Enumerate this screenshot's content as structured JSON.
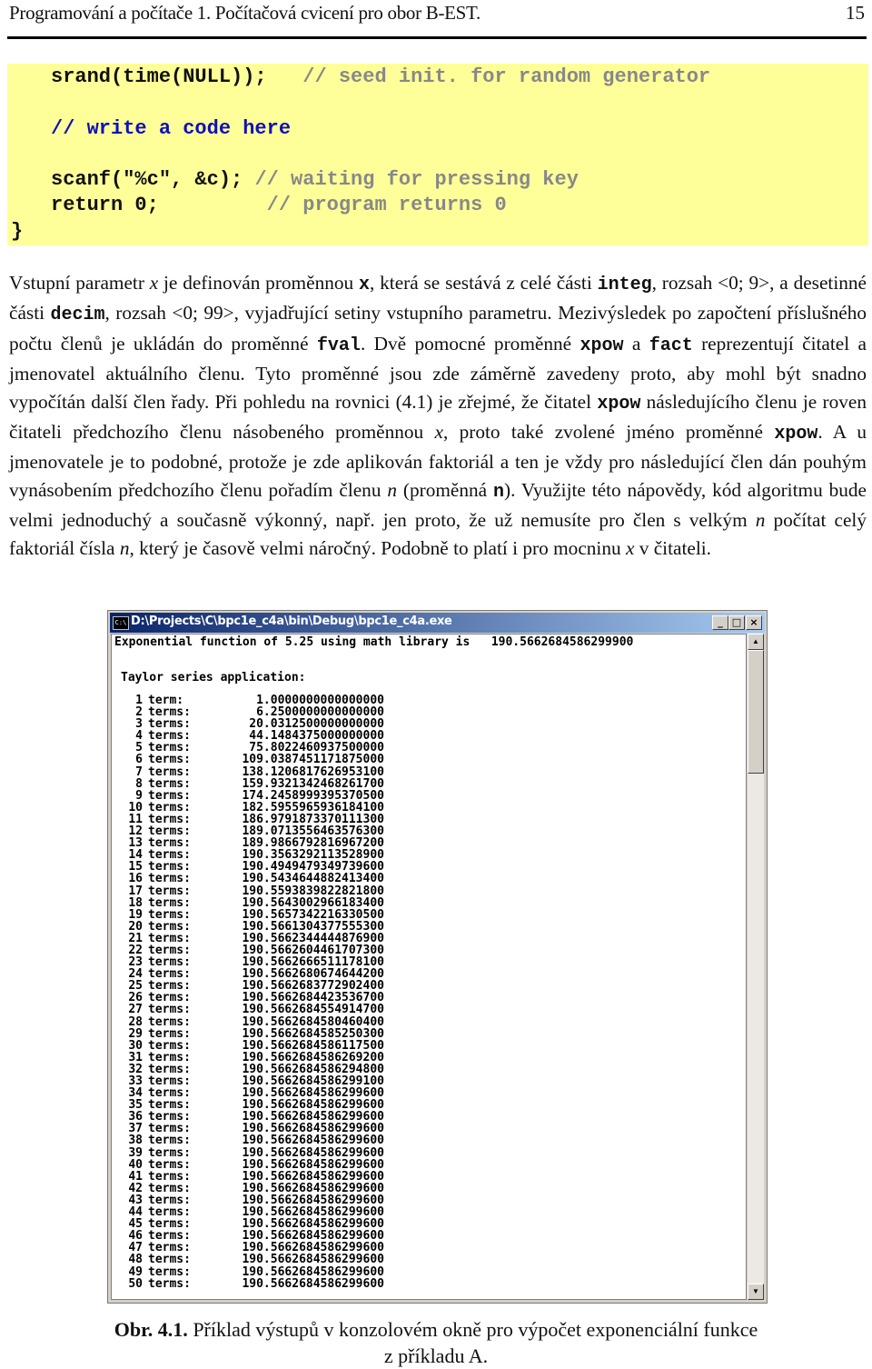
{
  "header": {
    "title": "Programování a počítače 1. Počítačová cvicení pro obor B-EST.",
    "page_number": "15"
  },
  "code_block": {
    "bg_color": "#ffff99",
    "lines": [
      {
        "code": "srand(time(NULL));",
        "pad": "   ",
        "comment": "// seed init. for random generator"
      },
      {
        "comment_blue": "// write a code here"
      },
      {
        "code": "scanf(\"%c\", &c);",
        "pad": " ",
        "comment": "// waiting for pressing key"
      },
      {
        "code": "return 0;",
        "pad": "         ",
        "comment": "// program returns 0"
      }
    ],
    "closing_brace": "}"
  },
  "paragraph": {
    "segments": [
      {
        "t": "Vstupní parametr "
      },
      {
        "t": "x",
        "s": "it"
      },
      {
        "t": " je definován proměnnou "
      },
      {
        "t": "x",
        "s": "mono"
      },
      {
        "t": ", která se sestává z celé části "
      },
      {
        "t": "integ",
        "s": "mono"
      },
      {
        "t": ", rozsah <0; 9>, a desetinné části "
      },
      {
        "t": "decim",
        "s": "mono"
      },
      {
        "t": ", rozsah <0; 99>, vyjadřující setiny vstupního parametru. Mezivýsledek po započtení příslušného počtu členů je ukládán do proměnné "
      },
      {
        "t": "fval",
        "s": "mono"
      },
      {
        "t": ". Dvě pomocné proměnné "
      },
      {
        "t": "xpow",
        "s": "mono"
      },
      {
        "t": " a "
      },
      {
        "t": "fact",
        "s": "mono"
      },
      {
        "t": " reprezentují čitatel a jmenovatel aktuálního členu. Tyto proměnné jsou zde záměrně zavedeny proto, aby mohl být snadno vypočítán další člen řady. Při pohledu na rovnici (4.1) je zřejmé, že čitatel "
      },
      {
        "t": "xpow",
        "s": "mono"
      },
      {
        "t": " následujícího členu je roven čitateli předchozího členu násobeného proměnnou "
      },
      {
        "t": "x",
        "s": "it"
      },
      {
        "t": ", proto také zvolené jméno proměnné "
      },
      {
        "t": "xpow",
        "s": "mono"
      },
      {
        "t": ". A u jmenovatele je to podobné, protože je zde aplikován faktoriál a ten je vždy pro následující člen dán pouhým vynásobením předchozího členu pořadím členu "
      },
      {
        "t": "n",
        "s": "it"
      },
      {
        "t": " (proměnná "
      },
      {
        "t": "n",
        "s": "mono"
      },
      {
        "t": "). Využijte této nápovědy, kód algoritmu bude velmi jednoduchý a současně výkonný, např. jen proto, že už nemusíte pro člen s velkým "
      },
      {
        "t": "n",
        "s": "it"
      },
      {
        "t": " počítat celý faktoriál čísla "
      },
      {
        "t": "n",
        "s": "it"
      },
      {
        "t": ", který je časově velmi náročný. Podobně to platí i pro mocninu "
      },
      {
        "t": "x",
        "s": "it"
      },
      {
        "t": " v čitateli."
      }
    ]
  },
  "console": {
    "title": "D:\\Projects\\C\\bpc1e_c4a\\bin\\Debug\\bpc1e_c4a.exe",
    "icon": "console-icon",
    "icon_text": "C:\\",
    "buttons": {
      "minimize": "_",
      "maximize": "□",
      "close": "×"
    },
    "scroll_up": "▲",
    "scroll_down": "▼",
    "title_color_start": "#0a246a",
    "title_color_end": "#a6caf0",
    "header_line": "Exponential function of 5.25 using math library is   190.5662684586299900",
    "taylor_label": "Taylor series application:",
    "rows": [
      {
        "n": "1",
        "label": "term:",
        "value": "1.0000000000000000"
      },
      {
        "n": "2",
        "label": "terms:",
        "value": "6.2500000000000000"
      },
      {
        "n": "3",
        "label": "terms:",
        "value": "20.0312500000000000"
      },
      {
        "n": "4",
        "label": "terms:",
        "value": "44.1484375000000000"
      },
      {
        "n": "5",
        "label": "terms:",
        "value": "75.8022460937500000"
      },
      {
        "n": "6",
        "label": "terms:",
        "value": "109.0387451171875000"
      },
      {
        "n": "7",
        "label": "terms:",
        "value": "138.1206817626953100"
      },
      {
        "n": "8",
        "label": "terms:",
        "value": "159.9321342468261700"
      },
      {
        "n": "9",
        "label": "terms:",
        "value": "174.2458999395370500"
      },
      {
        "n": "10",
        "label": "terms:",
        "value": "182.5955965936184100"
      },
      {
        "n": "11",
        "label": "terms:",
        "value": "186.9791873370111300"
      },
      {
        "n": "12",
        "label": "terms:",
        "value": "189.0713556463576300"
      },
      {
        "n": "13",
        "label": "terms:",
        "value": "189.9866792816967200"
      },
      {
        "n": "14",
        "label": "terms:",
        "value": "190.3563292113528900"
      },
      {
        "n": "15",
        "label": "terms:",
        "value": "190.4949479349739600"
      },
      {
        "n": "16",
        "label": "terms:",
        "value": "190.5434644882413400"
      },
      {
        "n": "17",
        "label": "terms:",
        "value": "190.5593839822821800"
      },
      {
        "n": "18",
        "label": "terms:",
        "value": "190.5643002966183400"
      },
      {
        "n": "19",
        "label": "terms:",
        "value": "190.5657342216330500"
      },
      {
        "n": "20",
        "label": "terms:",
        "value": "190.5661304377555300"
      },
      {
        "n": "21",
        "label": "terms:",
        "value": "190.5662344444876900"
      },
      {
        "n": "22",
        "label": "terms:",
        "value": "190.5662604461707300"
      },
      {
        "n": "23",
        "label": "terms:",
        "value": "190.5662666511178100"
      },
      {
        "n": "24",
        "label": "terms:",
        "value": "190.5662680674644200"
      },
      {
        "n": "25",
        "label": "terms:",
        "value": "190.5662683772902400"
      },
      {
        "n": "26",
        "label": "terms:",
        "value": "190.5662684423536700"
      },
      {
        "n": "27",
        "label": "terms:",
        "value": "190.5662684554914700"
      },
      {
        "n": "28",
        "label": "terms:",
        "value": "190.5662684580460400"
      },
      {
        "n": "29",
        "label": "terms:",
        "value": "190.5662684585250300"
      },
      {
        "n": "30",
        "label": "terms:",
        "value": "190.5662684586117500"
      },
      {
        "n": "31",
        "label": "terms:",
        "value": "190.5662684586269200"
      },
      {
        "n": "32",
        "label": "terms:",
        "value": "190.5662684586294800"
      },
      {
        "n": "33",
        "label": "terms:",
        "value": "190.5662684586299100"
      },
      {
        "n": "34",
        "label": "terms:",
        "value": "190.5662684586299600"
      },
      {
        "n": "35",
        "label": "terms:",
        "value": "190.5662684586299600"
      },
      {
        "n": "36",
        "label": "terms:",
        "value": "190.5662684586299600"
      },
      {
        "n": "37",
        "label": "terms:",
        "value": "190.5662684586299600"
      },
      {
        "n": "38",
        "label": "terms:",
        "value": "190.5662684586299600"
      },
      {
        "n": "39",
        "label": "terms:",
        "value": "190.5662684586299600"
      },
      {
        "n": "40",
        "label": "terms:",
        "value": "190.5662684586299600"
      },
      {
        "n": "41",
        "label": "terms:",
        "value": "190.5662684586299600"
      },
      {
        "n": "42",
        "label": "terms:",
        "value": "190.5662684586299600"
      },
      {
        "n": "43",
        "label": "terms:",
        "value": "190.5662684586299600"
      },
      {
        "n": "44",
        "label": "terms:",
        "value": "190.5662684586299600"
      },
      {
        "n": "45",
        "label": "terms:",
        "value": "190.5662684586299600"
      },
      {
        "n": "46",
        "label": "terms:",
        "value": "190.5662684586299600"
      },
      {
        "n": "47",
        "label": "terms:",
        "value": "190.5662684586299600"
      },
      {
        "n": "48",
        "label": "terms:",
        "value": "190.5662684586299600"
      },
      {
        "n": "49",
        "label": "terms:",
        "value": "190.5662684586299600"
      },
      {
        "n": "50",
        "label": "terms:",
        "value": "190.5662684586299600"
      }
    ]
  },
  "caption": {
    "label": "Obr. 4.1.",
    "text": " Příklad výstupů v konzolovém okně pro výpočet exponenciální funkce",
    "line2": "z příkladu A."
  }
}
